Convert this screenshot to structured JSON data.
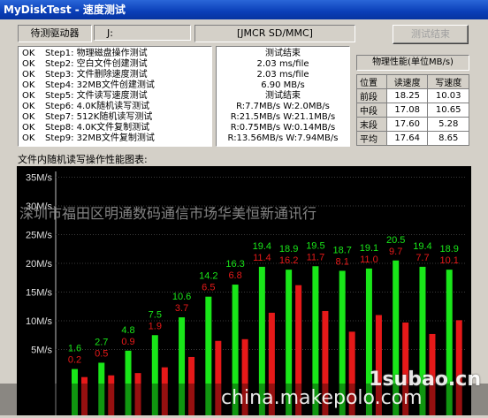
{
  "window": {
    "title": "MyDiskTest - 速度测试"
  },
  "drive": {
    "label": "待测驱动器",
    "letter": "J:",
    "name": "[JMCR SD/MMC]",
    "end_button": "测试结束"
  },
  "steps": [
    {
      "status": "OK",
      "name": "Step1: 物理磁盘操作测试",
      "result": "测试结束"
    },
    {
      "status": "OK",
      "name": "Step2: 空白文件创建测试",
      "result": "2.03 ms/file"
    },
    {
      "status": "OK",
      "name": "Step3: 文件删除速度测试",
      "result": "2.03 ms/file"
    },
    {
      "status": "OK",
      "name": "Step4: 32MB文件创建测试",
      "result": "6.90 MB/s"
    },
    {
      "status": "OK",
      "name": "Step5: 文件读写速度测试",
      "result": "测试结束"
    },
    {
      "status": "OK",
      "name": "Step6: 4.0K随机读写测试",
      "result": "R:7.7MB/s W:2.0MB/s"
    },
    {
      "status": "OK",
      "name": "Step7: 512K随机读写测试",
      "result": "R:21.5MB/s W:21.1MB/s"
    },
    {
      "status": "OK",
      "name": "Step8: 4.0K文件复制测试",
      "result": "R:0.75MB/s W:0.14MB/s"
    },
    {
      "status": "OK",
      "name": "Step9: 32MB文件复制测试",
      "result": "R:13.56MB/s W:7.94MB/s"
    }
  ],
  "perf": {
    "title": "物理性能(单位MB/s)",
    "headers": [
      "位置",
      "读速度",
      "写速度"
    ],
    "rows": [
      [
        "前段",
        "18.25",
        "10.03"
      ],
      [
        "中段",
        "17.08",
        "10.65"
      ],
      [
        "末段",
        "17.60",
        "5.28"
      ],
      [
        "平均",
        "17.64",
        "8.65"
      ]
    ]
  },
  "chart_title": "文件内随机读写操作性能图表:",
  "chart_data": {
    "type": "bar",
    "ylim": [
      0,
      35
    ],
    "y_ticks": [
      "5M/s",
      "10M/s",
      "15M/s",
      "20M/s",
      "25M/s",
      "30M/s",
      "35M/s"
    ],
    "series": [
      {
        "values": [
          1.6,
          2.7,
          4.8,
          7.5,
          10.6,
          14.2,
          16.3,
          19.4,
          18.9,
          19.5,
          18.7,
          19.1,
          20.5,
          19.4,
          18.9
        ],
        "color": "#19e619"
      },
      {
        "values": [
          0.2,
          0.5,
          0.9,
          1.9,
          3.7,
          6.5,
          6.8,
          11.4,
          16.2,
          11.7,
          8.1,
          11.0,
          9.7,
          7.7,
          10.1
        ],
        "color": "#e61919"
      }
    ],
    "read_labels": [
      "1.6",
      "2.7",
      "4.8",
      "7.5",
      "10.6",
      "14.2",
      "16.3",
      "19.4",
      "18.9",
      "19.5",
      "18.7",
      "19.1",
      "20.5",
      "19.4",
      "18.9"
    ],
    "write_labels": [
      "0.2",
      "0.5",
      "0.9",
      "1.9",
      "3.7",
      "6.5",
      "6.8",
      "11.4",
      "16.2",
      "11.7",
      "8.1",
      "11.0",
      "9.7",
      "7.7",
      "10.1"
    ]
  },
  "watermarks": {
    "overlay_text": "深圳市福田区明通数码通信市场华美恒新通讯行",
    "site1": "1subao.cn",
    "site2": "china.makepolo.com"
  }
}
